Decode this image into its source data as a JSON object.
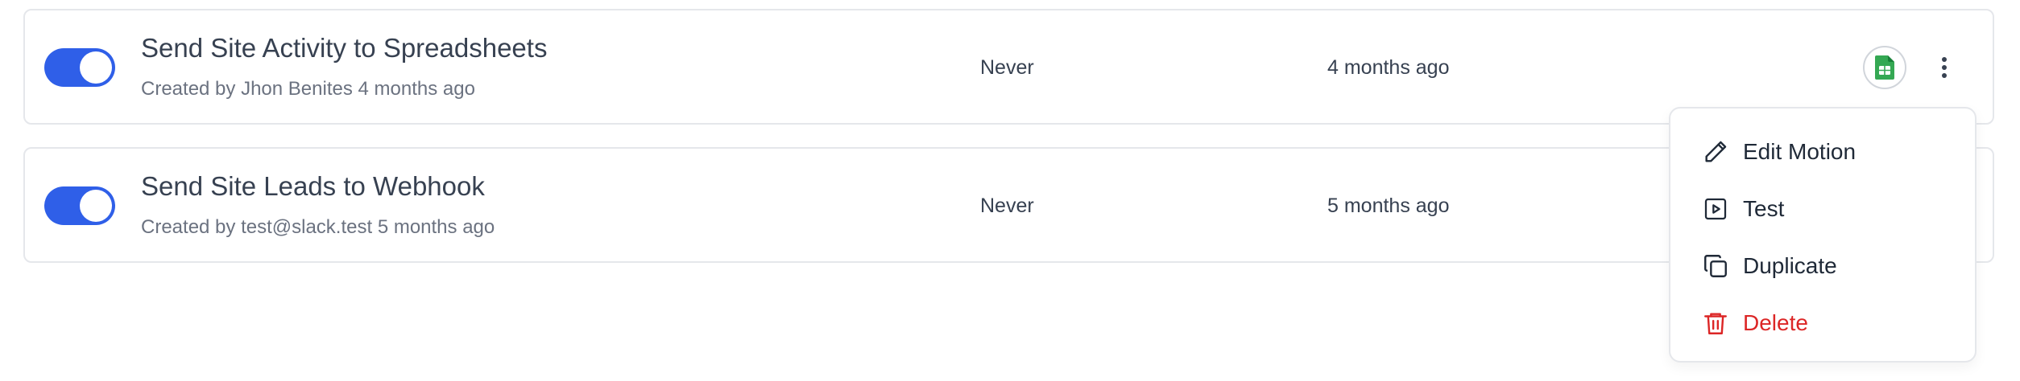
{
  "rows": [
    {
      "title": "Send Site Activity to Spreadsheets",
      "subtitle": "Created by Jhon Benites 4 months ago",
      "last_run": "Never",
      "updated": "4 months ago",
      "enabled": true,
      "integration_icon": "google-sheets-icon"
    },
    {
      "title": "Send Site Leads to Webhook",
      "subtitle": "Created by test@slack.test 5 months ago",
      "last_run": "Never",
      "updated": "5 months ago",
      "enabled": true
    }
  ],
  "menu": {
    "items": [
      {
        "label": "Edit Motion",
        "icon": "pencil-icon"
      },
      {
        "label": "Test",
        "icon": "play-icon"
      },
      {
        "label": "Duplicate",
        "icon": "copy-icon"
      },
      {
        "label": "Delete",
        "icon": "trash-icon"
      }
    ]
  },
  "colors": {
    "toggle_on": "#2f5fe8",
    "danger": "#dc2626",
    "sheets_green": "#34a853"
  }
}
